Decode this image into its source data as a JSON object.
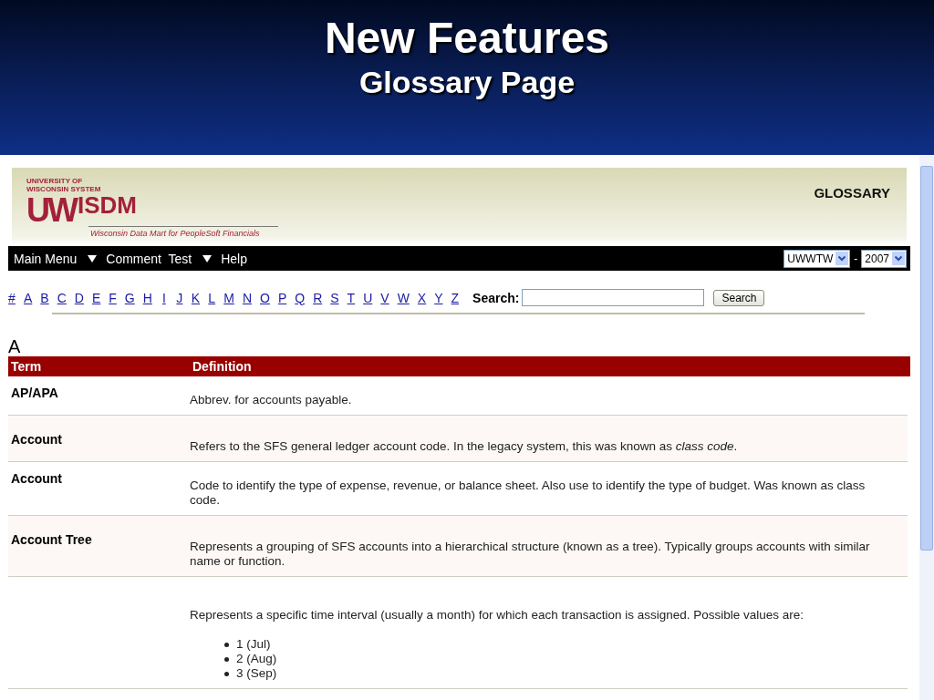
{
  "slide": {
    "title": "New Features",
    "subtitle": "Glossary Page"
  },
  "banner": {
    "logo_top": "UNIVERSITY OF",
    "logo_middle": "WISCONSIN SYSTEM",
    "logo_mark": "UW",
    "logo_name": "ISDM",
    "tagline": "Wisconsin Data Mart for PeopleSoft Financials",
    "page_title": "GLOSSARY"
  },
  "menu": [
    {
      "label": "Main Menu",
      "dropdown": true
    },
    {
      "label": "Comment  Test",
      "dropdown": true
    },
    {
      "label": "Help",
      "dropdown": false
    }
  ],
  "selectors": {
    "institution": "UWWTW",
    "separator": "-",
    "year": "2007"
  },
  "letters": [
    "#",
    "A",
    "B",
    "C",
    "D",
    "E",
    "F",
    "G",
    "H",
    "I",
    "J",
    "K",
    "L",
    "M",
    "N",
    "O",
    "P",
    "Q",
    "R",
    "S",
    "T",
    "U",
    "V",
    "W",
    "X",
    "Y",
    "Z"
  ],
  "search": {
    "label": "Search:",
    "button": "Search"
  },
  "section": "A",
  "table": {
    "columns": [
      "Term",
      "Definition"
    ],
    "rows": [
      {
        "term": "AP/APA",
        "definition": "Abbrev. for accounts payable."
      },
      {
        "term": "Account",
        "definition": "Refers to the SFS general ledger account code. In the legacy system, this was known as *class code*."
      },
      {
        "term": "Account",
        "definition": "Code to identify the type of expense, revenue, or balance sheet. Also use to identify the type of budget. Was known as class code."
      },
      {
        "term": "Account Tree",
        "definition": "Represents a grouping of SFS accounts into a hierarchical structure (known as a tree). Typically groups accounts with similar name or function."
      },
      {
        "definition": "Represents a specific time interval (usually a month) for which each transaction is assigned. Possible values are:",
        "values": [
          "1 (Jul)",
          "2 (Aug)",
          "3 (Sep)"
        ]
      }
    ]
  }
}
